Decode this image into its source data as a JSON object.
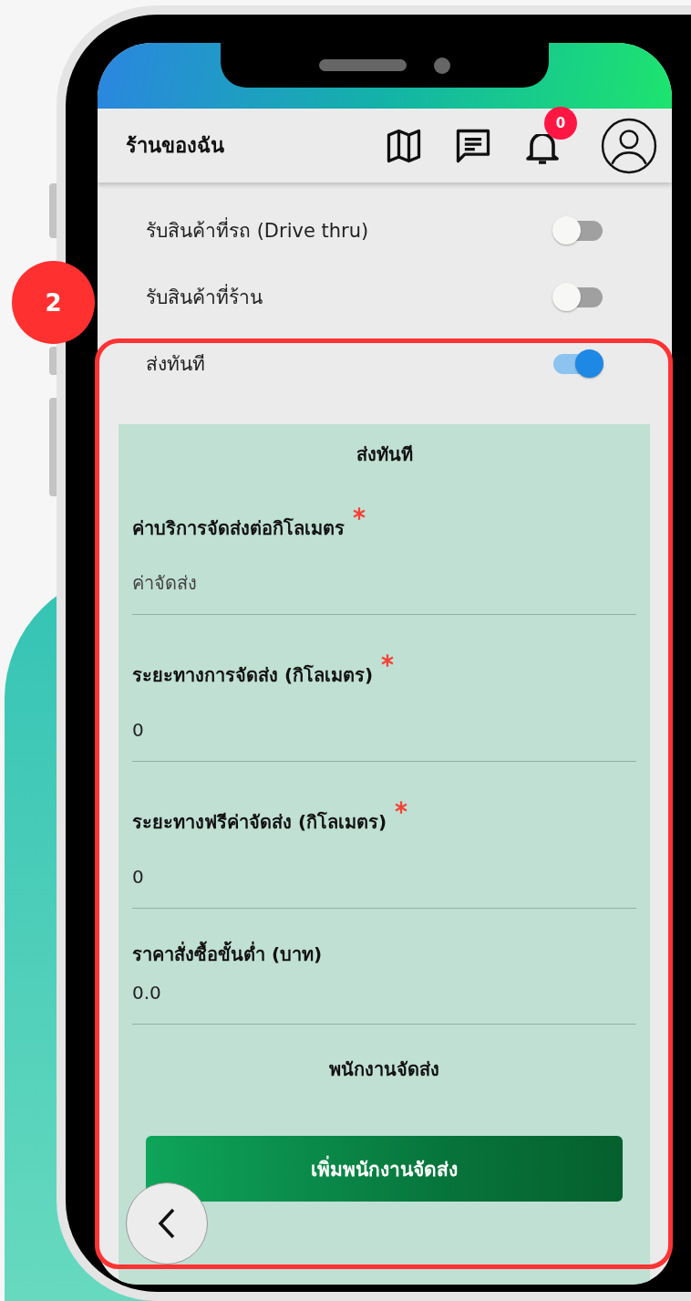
{
  "annotation": {
    "step": "2"
  },
  "header": {
    "title": "ร้านของฉัน",
    "notification_count": "0"
  },
  "toggles": [
    {
      "label": "รับสินค้าที่รถ (Drive thru)",
      "on": false
    },
    {
      "label": "รับสินค้าที่ร้าน",
      "on": false
    },
    {
      "label": "ส่งทันที",
      "on": true
    }
  ],
  "panel": {
    "title": "ส่งทันที",
    "fields": [
      {
        "label": "ค่าบริการจัดส่งต่อกิโลเมตร",
        "required": true,
        "placeholder": "ค่าจัดส่ง"
      },
      {
        "label": "ระยะทางการจัดส่ง (กิโลเมตร)",
        "required": true,
        "value": "0"
      },
      {
        "label": "ระยะทางฟรีค่าจัดส่ง (กิโลเมตร)",
        "required": true,
        "value": "0"
      },
      {
        "label": "ราคาสั่งซื้อขั้นต่ำ (บาท)",
        "required": false,
        "value": "0.0"
      }
    ],
    "staff_title": "พนักงานจัดส่ง",
    "add_button": "เพิ่มพนักงานจัดส่ง"
  }
}
